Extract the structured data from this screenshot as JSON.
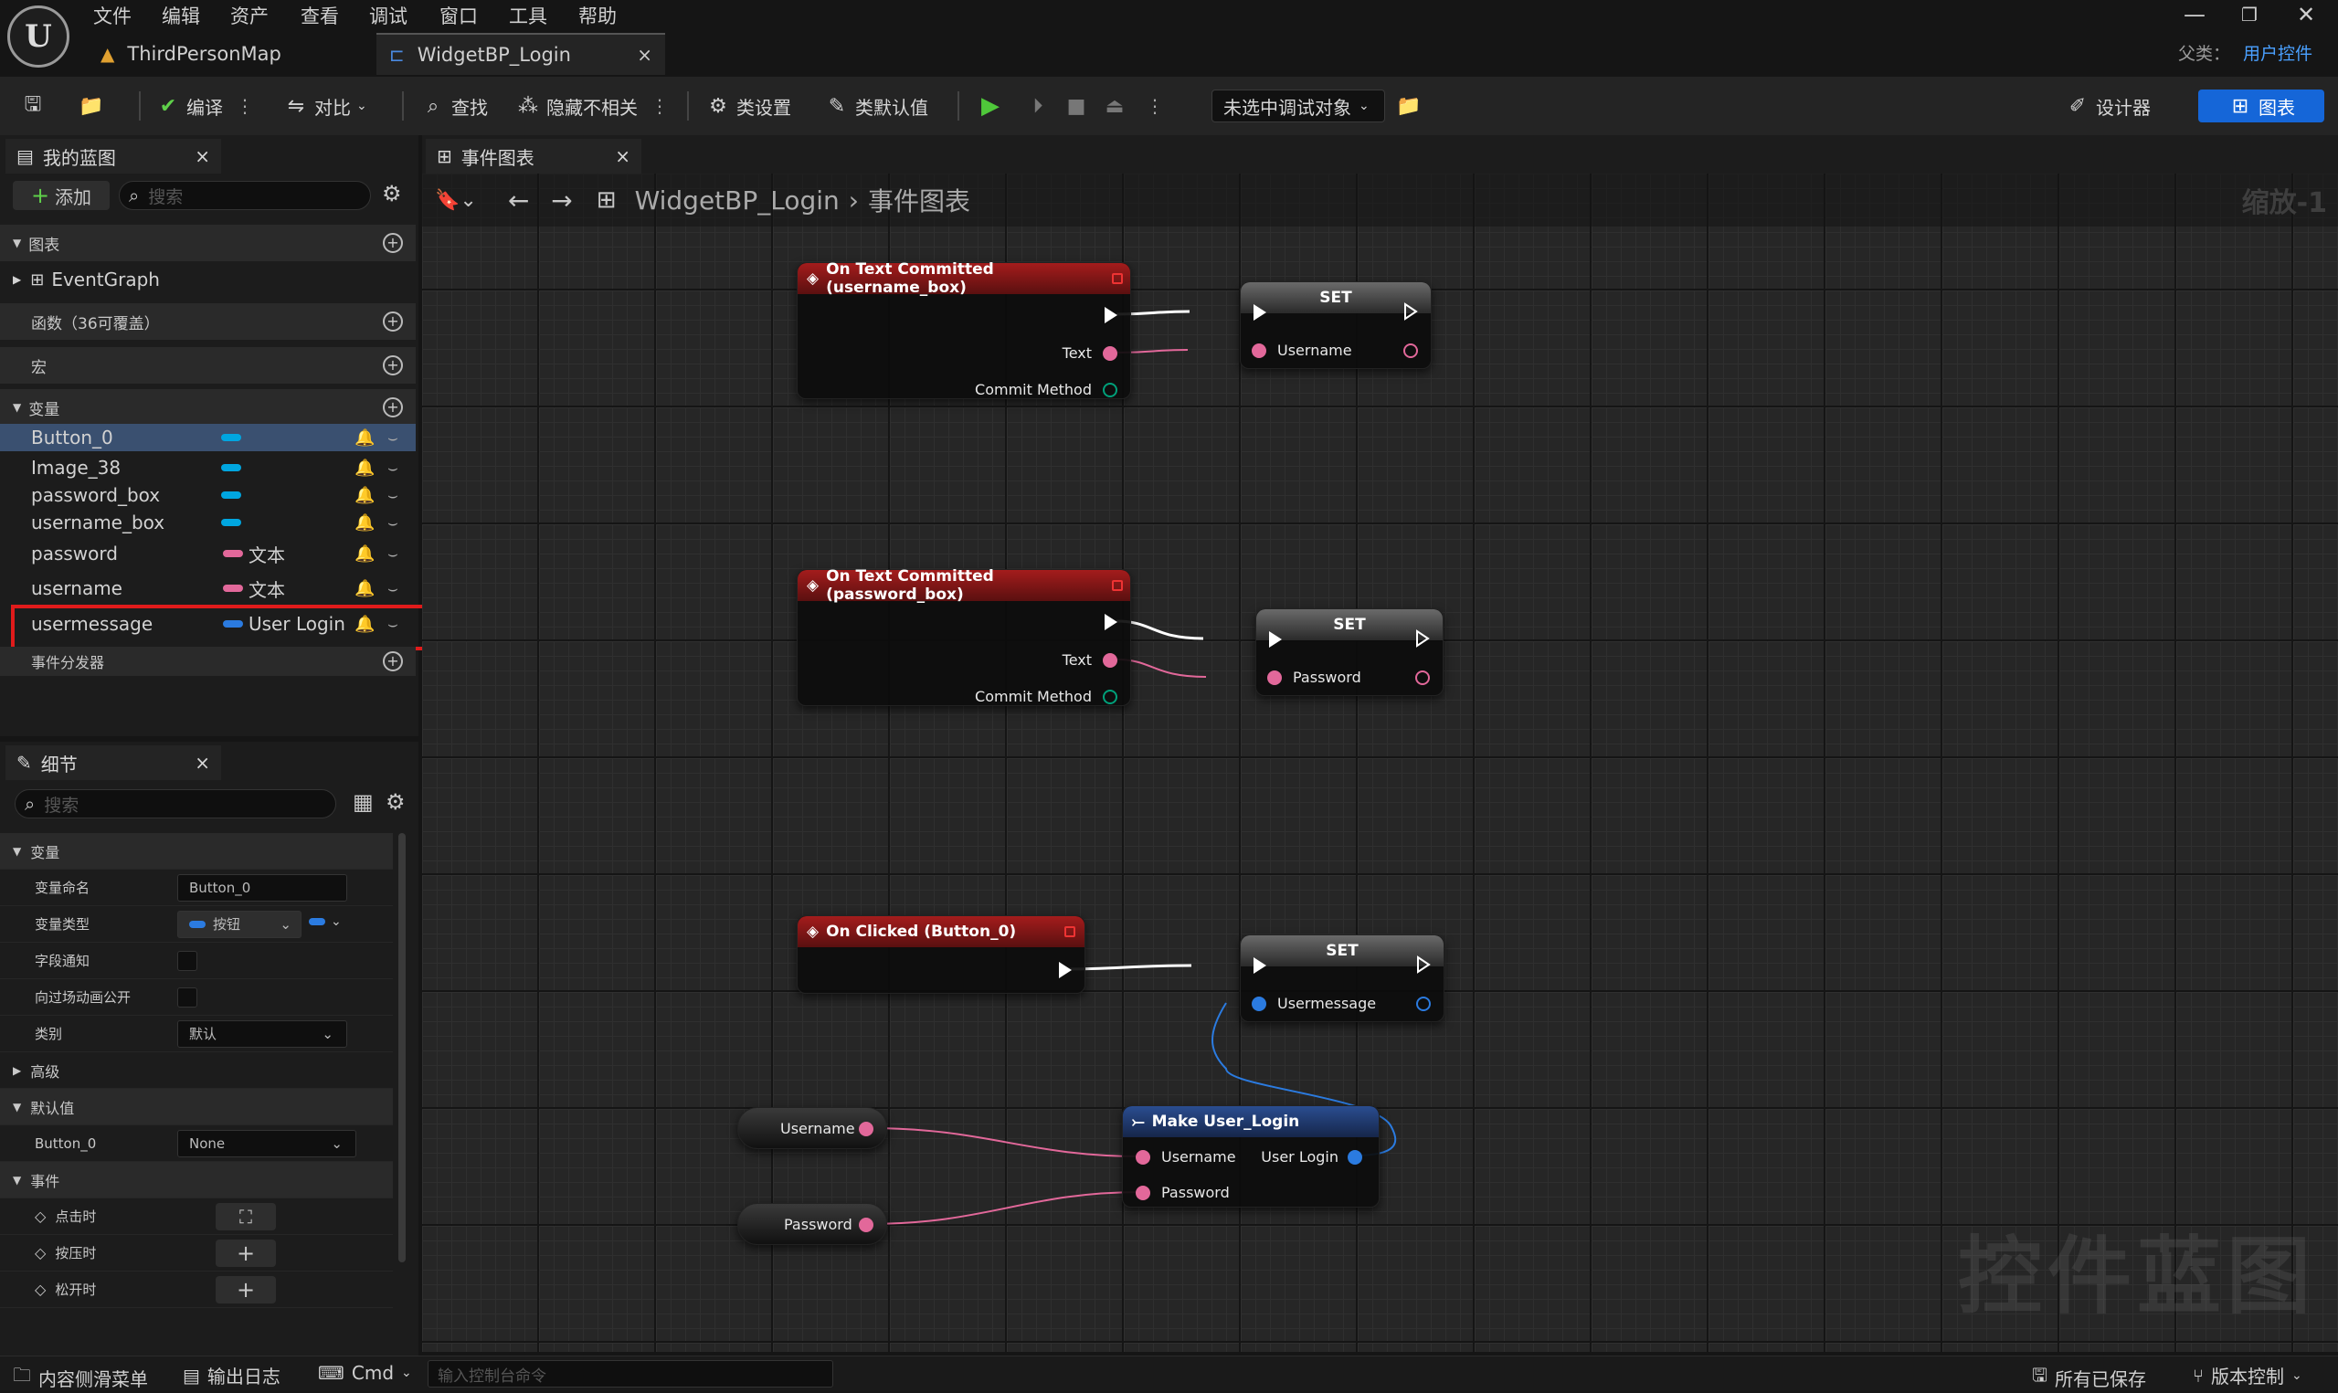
{
  "menu": [
    "文件",
    "编辑",
    "资产",
    "查看",
    "调试",
    "窗口",
    "工具",
    "帮助"
  ],
  "tabs": {
    "map": "ThirdPersonMap",
    "widget": "WidgetBP_Login"
  },
  "parent": {
    "label": "父类：",
    "value": "用户控件"
  },
  "toolbar": {
    "compile": "编译",
    "diff": "对比",
    "find": "查找",
    "hide": "隐藏不相关",
    "class_settings": "类设置",
    "class_defaults": "类默认值",
    "debug_target": "未选中调试对象",
    "designer": "设计器",
    "graph": "图表"
  },
  "my_blueprint": {
    "tab": "我的蓝图",
    "add": "添加",
    "search_placeholder": "搜索",
    "sections": {
      "graphs": "图表",
      "functions": "函数（36可覆盖）",
      "macros": "宏",
      "variables": "变量",
      "dispatchers": "事件分发器"
    },
    "event_graph": "EventGraph",
    "variables": [
      {
        "name": "Button_0",
        "type": ""
      },
      {
        "name": "Image_38",
        "type": ""
      },
      {
        "name": "password_box",
        "type": ""
      },
      {
        "name": "username_box",
        "type": ""
      },
      {
        "name": "password",
        "type": "文本"
      },
      {
        "name": "username",
        "type": "文本"
      },
      {
        "name": "usermessage",
        "type": "User Login"
      }
    ]
  },
  "details": {
    "tab": "细节",
    "search_placeholder": "搜索",
    "section_variable": "变量",
    "var_name_label": "变量命名",
    "var_name": "Button_0",
    "var_type_label": "变量类型",
    "var_type": "按钮",
    "field_notify_label": "字段通知",
    "expose_cinematics_label": "向过场动画公开",
    "category_label": "类别",
    "category": "默认",
    "advanced": "高级",
    "section_default": "默认值",
    "default_var": "Button_0",
    "default_value": "None",
    "section_events": "事件",
    "on_clicked": "点击时",
    "on_pressed": "按压时",
    "on_released": "松开时"
  },
  "graph": {
    "tab": "事件图表",
    "breadcrumb": {
      "bp": "WidgetBP_Login",
      "graph": "事件图表"
    },
    "zoom": "缩放-1",
    "watermark": "控件蓝图",
    "nodes": {
      "commit_user": {
        "title": "On Text Committed (username_box)",
        "text": "Text",
        "method": "Commit Method"
      },
      "commit_pass": {
        "title": "On Text Committed (password_box)",
        "text": "Text",
        "method": "Commit Method"
      },
      "clicked": {
        "title": "On Clicked (Button_0)"
      },
      "set_user": {
        "title": "SET",
        "pin": "Username"
      },
      "set_pass": {
        "title": "SET",
        "pin": "Password"
      },
      "set_msg": {
        "title": "SET",
        "pin": "Usermessage"
      },
      "get_user": {
        "label": "Username"
      },
      "get_pass": {
        "label": "Password"
      },
      "make": {
        "title": "Make User_Login",
        "in1": "Username",
        "in2": "Password",
        "out": "User Login"
      }
    }
  },
  "statusbar": {
    "content_drawer": "内容侧滑菜单",
    "output_log": "输出日志",
    "cmd": "Cmd",
    "console_placeholder": "输入控制台命令",
    "all_saved": "所有已保存",
    "source_control": "版本控制"
  },
  "colors": {
    "accent": "#1566d8",
    "text_pin": "#e2689a",
    "struct_pin": "#2b7be0",
    "object_pin": "#00a6e0",
    "highlight": "#e01b1b"
  }
}
